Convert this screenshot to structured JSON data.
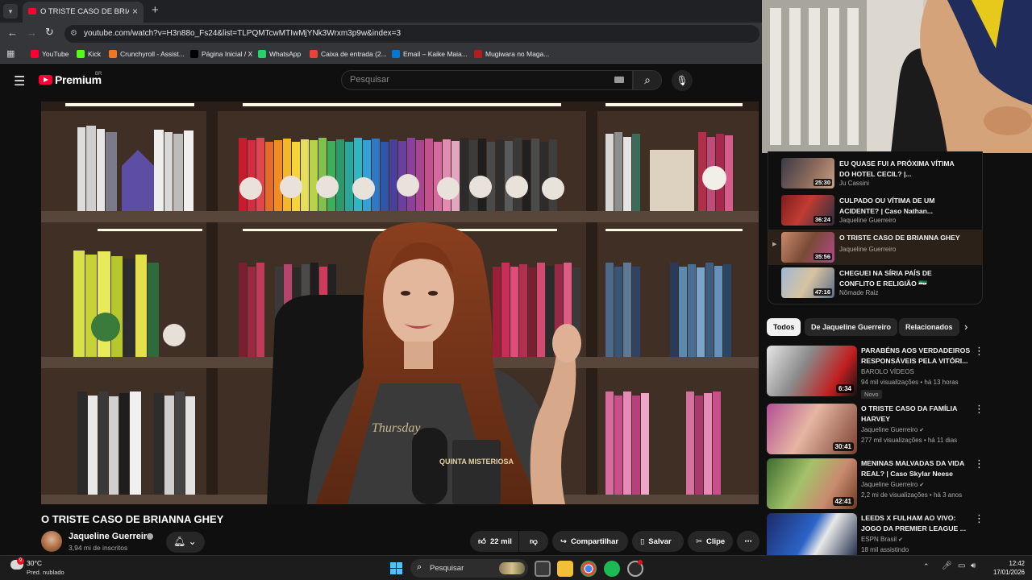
{
  "browser": {
    "tab_title": "O TRISTE CASO DE BRIANNA G",
    "url": "youtube.com/watch?v=H3n88o_Fs24&list=TLPQMTcwMTIwMjYNk3Wrxm3p9w&index=3",
    "bookmarks": [
      {
        "label": "YouTube",
        "color": "#ff0033"
      },
      {
        "label": "Kick",
        "color": "#53fc18"
      },
      {
        "label": "Crunchyroll - Assist...",
        "color": "#f47521"
      },
      {
        "label": "Página Inicial / X",
        "color": "#000000"
      },
      {
        "label": "WhatsApp",
        "color": "#25d366"
      },
      {
        "label": "Caixa de entrada (2...",
        "color": "#ea4335"
      },
      {
        "label": "Email – Kaike Maia...",
        "color": "#0078d4"
      },
      {
        "label": "Mugiwara no Maga...",
        "color": "#b71c1c"
      }
    ]
  },
  "header": {
    "logo": "Premium",
    "region": "BR",
    "search_placeholder": "Pesquisar"
  },
  "video": {
    "title": "O TRISTE CASO DE BRIANNA GHEY",
    "channel": "Jaqueline Guerreiro",
    "subscribers": "3,94 mi de inscritos",
    "likes": "22 mil",
    "share_label": "Compartilhar",
    "save_label": "Salvar",
    "clip_label": "Clipe",
    "mug_text": "QUINTA MISTERIOSA",
    "shirt_text": "Thursday"
  },
  "playlist": [
    {
      "title": "EU QUASE FUI A PRÓXIMA VÍTIMA DO HOTEL CECIL? |...",
      "channel": "Ju Cassini",
      "duration": "25:30",
      "thumb": "linear-gradient(120deg,#3a3a46,#8b6a5c 55%,#c9a083)",
      "active": false
    },
    {
      "title": "CULPADO OU VÍTIMA DE UM ACIDENTE? | Caso Nathan...",
      "channel": "Jaqueline Guerreiro",
      "duration": "36:24",
      "thumb": "linear-gradient(120deg,#7c1d1d,#c13c32 45%,#2a2d3e)",
      "active": false
    },
    {
      "title": "O TRISTE CASO DE BRIANNA GHEY",
      "channel": "Jaqueline Guerreiro",
      "duration": "35:56",
      "thumb": "linear-gradient(120deg,#c98a6e,#7a4a35 50%,#b14a8a)",
      "active": true
    },
    {
      "title": "CHEGUEI NA SÍRIA PAÍS DE CONFLITO E RELIGIÃO 🇸🇾",
      "channel": "Nômade Raiz",
      "duration": "47:16",
      "thumb": "linear-gradient(120deg,#9fb8d6,#d7c3a0 50%,#5b6d88)",
      "active": false
    }
  ],
  "chips": [
    "Todos",
    "De Jaqueline Guerreiro",
    "Relacionados"
  ],
  "recommendations": [
    {
      "title": "PARABÉNS AOS VERDADEIROS RESPONSÁVEIS PELA VITÓRI...",
      "channel": "BAROLO VÍDEOS",
      "meta": "94 mil visualizações • há 13 horas",
      "badge": "Novo",
      "duration": "6:34",
      "thumb": "linear-gradient(120deg,#e7e7e7,#8a8a8a 40%,#c21f1f 75%,#111)",
      "verified": false
    },
    {
      "title": "O TRISTE CASO DA FAMÍLIA HARVEY",
      "channel": "Jaqueline Guerreiro",
      "meta": "277 mil visualizações • há 11 dias",
      "badge": "",
      "duration": "30:41",
      "thumb": "linear-gradient(120deg,#b34f94,#e6b6a3 45%,#7a4030)",
      "verified": true
    },
    {
      "title": "MENINAS MALVADAS DA VIDA REAL? | Caso Skylar Neese",
      "channel": "Jaqueline Guerreiro",
      "meta": "2,2 mi de visualizações • há 3 anos",
      "badge": "",
      "duration": "42:41",
      "thumb": "linear-gradient(120deg,#3f6b2f,#a3c26a 40%,#c98a6e 70%,#6b3a22)",
      "verified": true
    },
    {
      "title": "LEEDS X FULHAM AO VIVO: JOGO DA PREMIER LEAGUE ...",
      "channel": "ESPN Brasil",
      "meta": "18 mil assistindo",
      "badge": "",
      "duration": "",
      "thumb": "linear-gradient(120deg,#1d2a6b,#2c64c7 45%,#e8e8e8 60%,#0c1a3a)",
      "verified": true
    }
  ],
  "taskbar": {
    "temperature": "30°C",
    "forecast": "Pred. nublado",
    "weather_badge": "9",
    "search": "Pesquisar",
    "time": "12:42",
    "date": "17/01/2026"
  }
}
